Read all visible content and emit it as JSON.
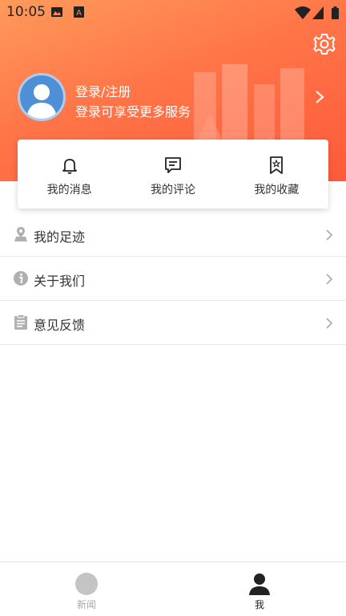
{
  "status_bar": {
    "time": "10:05",
    "icons": [
      "image-icon",
      "a-icon",
      "wifi-icon",
      "signal-icon",
      "battery-icon"
    ]
  },
  "header": {
    "login_title": "登录/注册",
    "login_subtitle": "登录可享受更多服务",
    "settings_icon": "gear-icon"
  },
  "quick_actions": [
    {
      "label": "我的消息",
      "icon": "bell-icon"
    },
    {
      "label": "我的评论",
      "icon": "comment-icon"
    },
    {
      "label": "我的收藏",
      "icon": "bookmark-icon"
    }
  ],
  "menu": [
    {
      "label": "我的足迹",
      "icon": "location-pin-icon"
    },
    {
      "label": "关于我们",
      "icon": "info-icon"
    },
    {
      "label": "意见反馈",
      "icon": "clipboard-icon"
    }
  ],
  "tabbar": [
    {
      "label": "新闻",
      "icon": "news-icon",
      "active": false
    },
    {
      "label": "我",
      "icon": "person-icon",
      "active": true
    }
  ],
  "colors": {
    "header_gradient_start": "#ff9a5a",
    "header_gradient_end": "#ff5a3a",
    "avatar_bg": "#4f8fd6",
    "text": "#333333",
    "icon_gray": "#b0b0b0"
  }
}
